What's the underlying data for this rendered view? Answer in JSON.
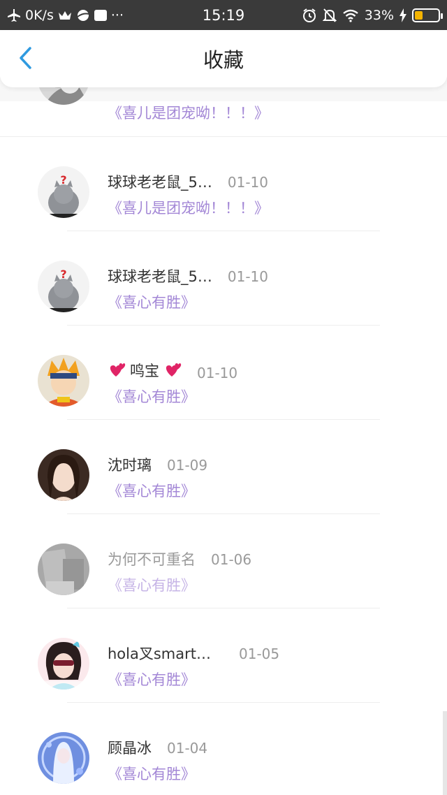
{
  "status_bar": {
    "net_speed": "0K/s",
    "time": "15:19",
    "battery_percent": "33%",
    "battery_level": 0.33,
    "battery_color": "#f4b400"
  },
  "header": {
    "title": "收藏",
    "back_icon": "chevron-left-icon",
    "back_color": "#2f9ae0"
  },
  "list": {
    "items": [
      {
        "name": "",
        "date": "",
        "book": "《喜儿是团宠呦！！！》",
        "avatar": "grayscale-photo"
      },
      {
        "name": "球球老老鼠_5…",
        "date": "01-10",
        "book": "《喜儿是团宠呦！！！》",
        "avatar": "gray-cat"
      },
      {
        "name": "球球老老鼠_5…",
        "date": "01-10",
        "book": "《喜心有胜》",
        "avatar": "gray-cat"
      },
      {
        "name": "鸣宝",
        "date": "01-10",
        "book": "《喜心有胜》",
        "avatar": "anime-ninja"
      },
      {
        "name": "沈时璃",
        "date": "01-09",
        "book": "《喜心有胜》",
        "avatar": "girl-portrait"
      },
      {
        "name": "为何不可重名",
        "date": "01-06",
        "book": "《喜心有胜》",
        "avatar": "dim-photo"
      },
      {
        "name": "hola叉smart…",
        "date": "01-05",
        "book": "《喜心有胜》",
        "avatar": "girl-sunglasses"
      },
      {
        "name": "顾晶冰",
        "date": "01-04",
        "book": "《喜心有胜》",
        "avatar": "blue-fantasy"
      }
    ]
  },
  "colors": {
    "book_purple": "#a387d6",
    "status_bg": "#3a3a3a"
  }
}
